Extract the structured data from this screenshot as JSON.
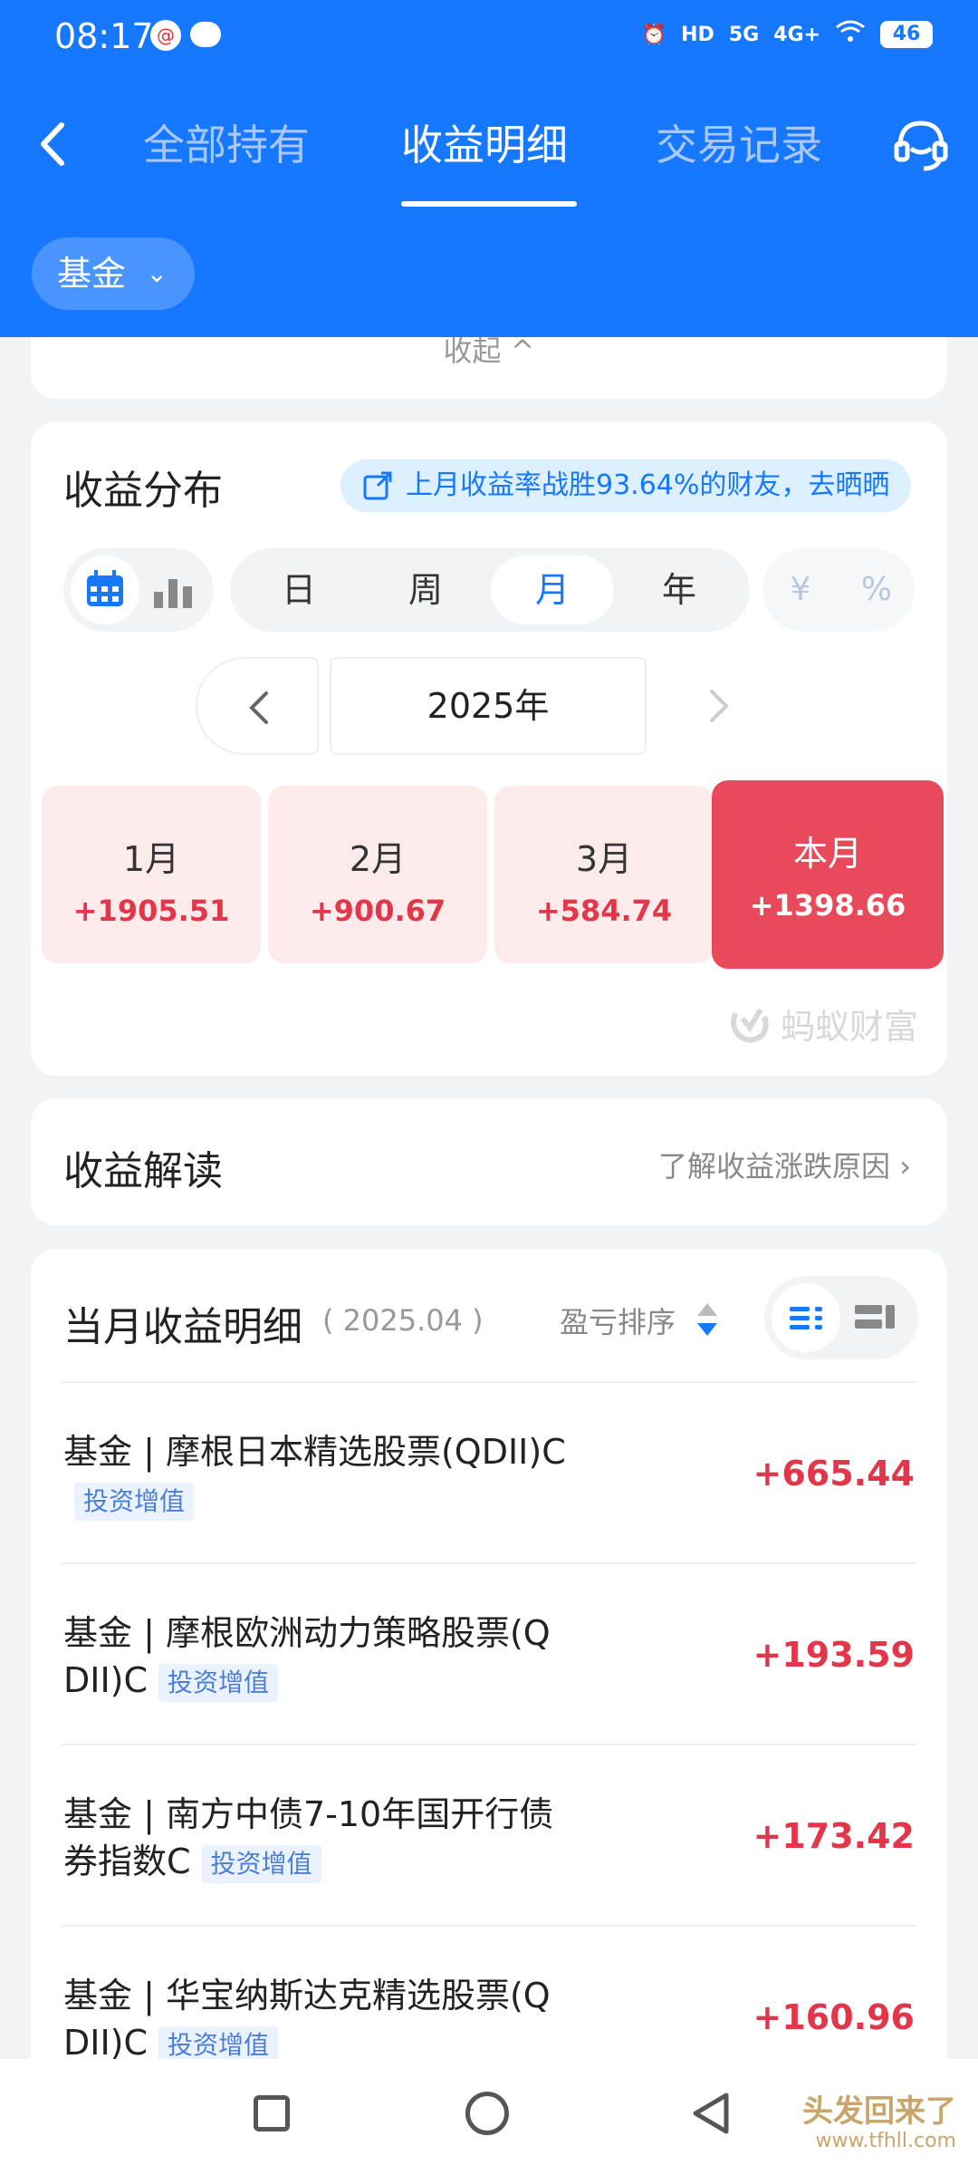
{
  "status_bar": {
    "time": "08:17",
    "notif_badge": "@",
    "network1": "HD",
    "network2": "5G",
    "network3": "4G+",
    "battery": "46"
  },
  "nav": {
    "tabs": [
      {
        "label": "全部持有"
      },
      {
        "label": "收益明细"
      },
      {
        "label": "交易记录"
      }
    ],
    "active_tab": "收益明细"
  },
  "filter": {
    "label": "基金"
  },
  "collapse": {
    "label": "收起 ^"
  },
  "distribution": {
    "title": "收益分布",
    "share_badge": "上月收益率战胜93.64%的财友，去晒晒",
    "periods": [
      "日",
      "周",
      "月",
      "年"
    ],
    "active_period": "月",
    "units": [
      "¥",
      "%"
    ],
    "year": "2025年",
    "months": [
      {
        "name": "1月",
        "value": "+1905.51"
      },
      {
        "name": "2月",
        "value": "+900.67"
      },
      {
        "name": "3月",
        "value": "+584.74"
      },
      {
        "name": "本月",
        "value": "+1398.66"
      }
    ],
    "watermark": "蚂蚁财富"
  },
  "interpretation": {
    "title": "收益解读",
    "link": "了解收益涨跌原因 ›"
  },
  "detail": {
    "title": "当月收益明细",
    "period": "( 2025.04 )",
    "sort_label": "盈亏排序",
    "items": [
      {
        "name": "基金 | 摩根日本精选股票(QDII)C",
        "tag": "投资增值",
        "amount": "+665.44"
      },
      {
        "name": "基金 | 摩根欧洲动力策略股票(QDII)C",
        "tag": "投资增值",
        "amount": "+193.59"
      },
      {
        "name": "基金 | 南方中债7-10年国开行债券指数C",
        "tag": "投资增值",
        "amount": "+173.42"
      },
      {
        "name": "基金 | 华宝纳斯达克精选股票(QDII)C",
        "tag": "投资增值",
        "amount": "+160.96"
      }
    ]
  },
  "site_watermark": {
    "title": "头发回来了",
    "url": "www.tfhll.com"
  },
  "colors": {
    "brand_blue": "#1677ff",
    "profit_red": "#e2374a",
    "current_month_red": "#e84a5b"
  }
}
